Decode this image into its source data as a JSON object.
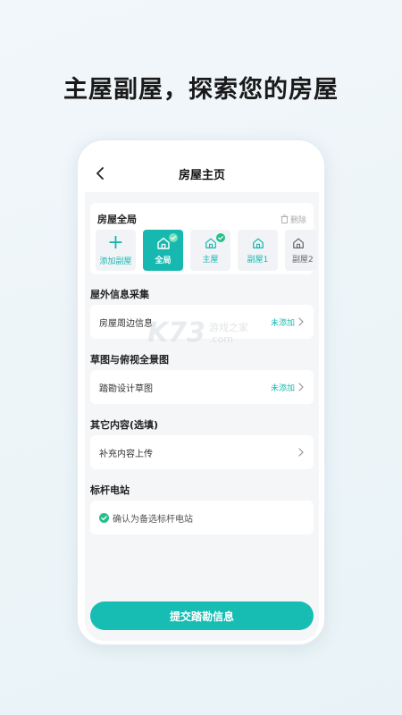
{
  "headline": "主屋副屋，探索您的房屋",
  "navbar": {
    "title": "房屋主页"
  },
  "house_card": {
    "title": "房屋全局",
    "delete_label": "删除",
    "tiles": [
      {
        "label": "添加副屋",
        "icon": "plus-icon"
      },
      {
        "label": "全局",
        "icon": "house-icon",
        "active": true,
        "checked": true
      },
      {
        "label": "主屋",
        "icon": "house-icon",
        "checked": true
      },
      {
        "label": "副屋1",
        "icon": "house-icon"
      },
      {
        "label": "副屋2",
        "icon": "house-icon"
      }
    ]
  },
  "sections": [
    {
      "title": "屋外信息采集",
      "row_label": "房屋周边信息",
      "status": "未添加"
    },
    {
      "title": "草图与俯视全景图",
      "row_label": "踏勘设计草图",
      "status": "未添加"
    },
    {
      "title": "其它内容(选填)",
      "row_label": "补充内容上传",
      "status": ""
    },
    {
      "title": "标杆电站",
      "row_label": "确认为备选标杆电站",
      "status": ""
    }
  ],
  "submit_label": "提交踏勘信息",
  "watermark": {
    "logo": "K73",
    "line1": "游戏之家",
    "line2": ".com"
  },
  "colors": {
    "accent": "#16b8b0",
    "check": "#22c08a"
  }
}
